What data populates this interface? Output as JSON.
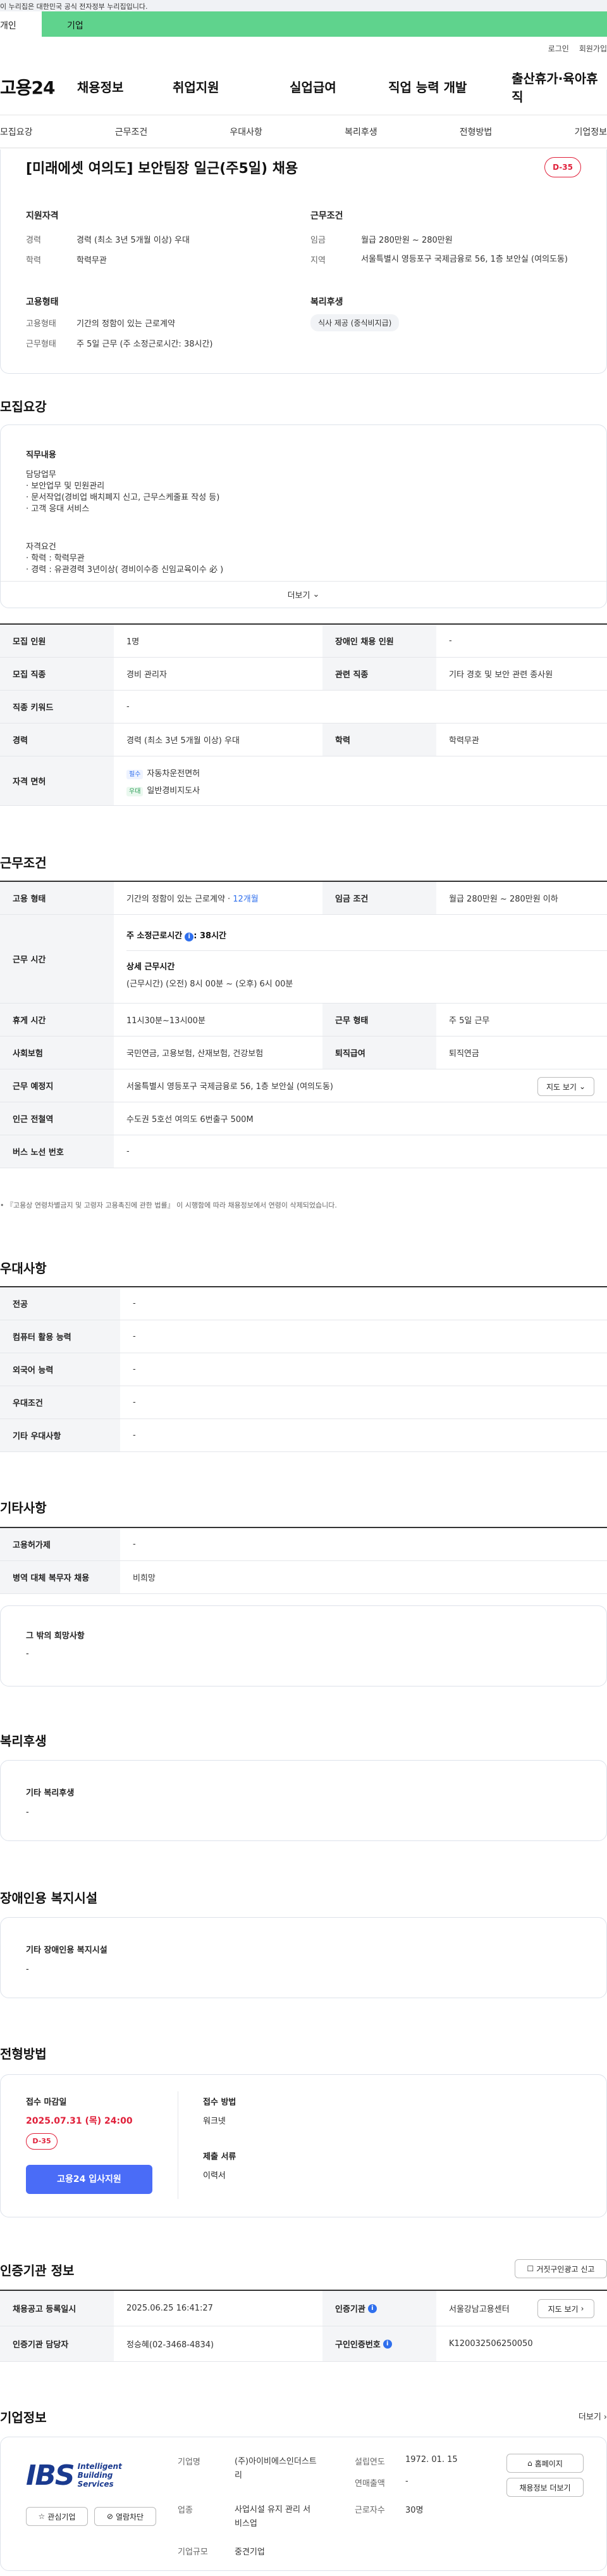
{
  "gov_banner": "이 누리집은 대한민국 공식 전자정부 누리집입니다.",
  "top_tabs": {
    "personal": "개인",
    "company": "기업"
  },
  "util": {
    "login": "로그인",
    "join": "회원가입"
  },
  "logo": "고용24",
  "gnb": [
    "채용정보",
    "취업지원",
    "실업급여",
    "직업 능력 개발",
    "출산휴가·육아휴직"
  ],
  "snb": [
    "모집요강",
    "근무조건",
    "우대사항",
    "복리후생",
    "전형방법",
    "기업정보"
  ],
  "job": {
    "title": "[미래에셋 여의도] 보안팀장 일근(주5일) 채용",
    "dday": "D-35",
    "qual_title": "지원자격",
    "career_label": "경력",
    "career_value": "경력 (최소 3년 5개월 이상) 우대",
    "edu_label": "학력",
    "edu_value": "학력무관",
    "work_title": "근무조건",
    "wage_label": "임금",
    "wage_value": "월급 280만원 ~ 280만원",
    "region_label": "지역",
    "region_value": "서울특별시 영등포구 국제금융로 56, 1층 보안실 (여의도동)",
    "emp_title": "고용형태",
    "emp_label": "고용형태",
    "emp_value": "기간의 정함이 있는 근로계약",
    "hours_label": "근무형태",
    "hours_value": "주 5일 근무 (주 소정근로시간: 38시간)",
    "welfare_title": "복리후생",
    "welfare_tag": "식사 제공 (중식비지급)"
  },
  "recruit": {
    "heading": "모집요강",
    "duty_title": "직무내용",
    "duty_lines": [
      "담당업무",
      "· 보안업무 및 민원관리",
      "· 문서작업(경비업 배치폐지 신고, 근무스케줄표 작성 등)",
      "· 고객 응대 서비스"
    ],
    "req_title": "자격요건",
    "req_lines": [
      "· 학력 : 학력무관",
      "· 경력 : 유관경력 3년이상( 경비이수증 신임교육이수 必 )"
    ],
    "more": "더보기",
    "rows": {
      "count_label": "모집 인원",
      "count_value": "1명",
      "disabled_label": "장애인 채용 인원",
      "disabled_value": "-",
      "job_label": "모집 직종",
      "job_value": "경비 관리자",
      "related_label": "관련 직종",
      "related_value": "기타 경호 및 보안 관련 종사원",
      "keyword_label": "직종 키워드",
      "keyword_value": "-",
      "career_label": "경력",
      "career_value": "경력 (최소 3년 5개월 이상) 우대",
      "edu_label": "학력",
      "edu_value": "학력무관",
      "license_label": "자격 면허",
      "license1_tag": "필수",
      "license1": "자동차운전면허",
      "license2_tag": "우대",
      "license2": "일반경비지도사"
    }
  },
  "conditions": {
    "heading": "근무조건",
    "emp_label": "고용 형태",
    "emp_value": "기간의 정함이 있는 근로계약 · ",
    "emp_months": "12개월",
    "wage_label": "임금 조건",
    "wage_value": "월급 280만원 ~ 280만원 이하",
    "time_label": "근무 시간",
    "std_title": "주 소정근로시간",
    "std_value": ": 38시간",
    "detail_title": "상세 근무시간",
    "detail_value": "(근무시간) (오전) 8시 00분 ~ (오후) 6시 00분",
    "break_label": "휴게 시간",
    "break_value": "11시30분~13시00분",
    "type_label": "근무 형태",
    "type_value": "주 5일 근무",
    "insurance_label": "사회보험",
    "insurance_value": "국민연금, 고용보험, 산재보험, 건강보험",
    "retire_label": "퇴직급여",
    "retire_value": "퇴직연금",
    "place_label": "근무 예정지",
    "place_value": "서울특별시 영등포구 국제금융로 56, 1층 보안실 (여의도동)",
    "map_btn": "지도 보기",
    "subway_label": "인근 전철역",
    "subway_value": "수도권 5호선 여의도 6번출구 500M",
    "bus_label": "버스 노선 번호",
    "bus_value": "-",
    "note": "『고용상 연령차별금지 및 고령자 고용촉진에 관한 법률』 이 시행함에 따라 채용정보에서 연령이 삭제되었습니다."
  },
  "preference": {
    "heading": "우대사항",
    "rows": [
      {
        "label": "전공",
        "value": "-"
      },
      {
        "label": "컴퓨터 활용 능력",
        "value": "-"
      },
      {
        "label": "외국어 능력",
        "value": "-"
      },
      {
        "label": "우대조건",
        "value": "-"
      },
      {
        "label": "기타 우대사항",
        "value": "-"
      }
    ]
  },
  "etc": {
    "heading": "기타사항",
    "rows": [
      {
        "label": "고용허가제",
        "value": "-"
      },
      {
        "label": "병역 대체 복무자 채용",
        "value": "비희망"
      }
    ],
    "other_title": "그 밖의 희망사항",
    "other_value": "-"
  },
  "welfare": {
    "heading": "복리후생",
    "box_title": "기타 복리후생",
    "box_value": "-"
  },
  "facility": {
    "heading": "장애인용 복지시설",
    "box_title": "기타 장애인용 복지시설",
    "box_value": "-"
  },
  "selection": {
    "heading": "전형방법",
    "deadline_label": "접수 마감일",
    "deadline_value": "2025.07.31 (목) 24:00",
    "dday": "D-35",
    "apply_btn": "고용24 입사지원",
    "method_label": "접수 방법",
    "method_value": "워크넷",
    "docs_label": "제출 서류",
    "docs_value": "이력서"
  },
  "agency": {
    "heading": "인증기관 정보",
    "report_btn": "거짓구인광고 신고",
    "reg_label": "채용공고 등록일시",
    "reg_value": "2025.06.25 16:41:27",
    "org_label": "인증기관",
    "org_value": "서울강남고용센터",
    "map_btn": "지도 보기",
    "mgr_label": "인증기관 담당자",
    "mgr_value": "정승혜(02-3468-4834)",
    "no_label": "구인인증번호",
    "no_value": "K120032506250050"
  },
  "company": {
    "heading": "기업정보",
    "more": "더보기",
    "logo_mark": "IBS",
    "logo_text": [
      "Intelligent",
      "Building",
      "Services"
    ],
    "fav_btn": "관심기업",
    "block_btn": "열람차단",
    "name_label": "기업명",
    "name_value": "(주)아이비에스인더스트리",
    "est_label": "설립연도",
    "est_value": "1972. 01. 15",
    "home_btn": "홈페이지",
    "sales_label": "연매출액",
    "sales_value": "-",
    "biz_label": "업종",
    "biz_value": "사업시설 유지 관리 서비스업",
    "emp_label": "근로자수",
    "emp_value": "30명",
    "jobs_btn": "채용정보 더보기",
    "size_label": "기업규모",
    "size_value": "중견기업"
  }
}
